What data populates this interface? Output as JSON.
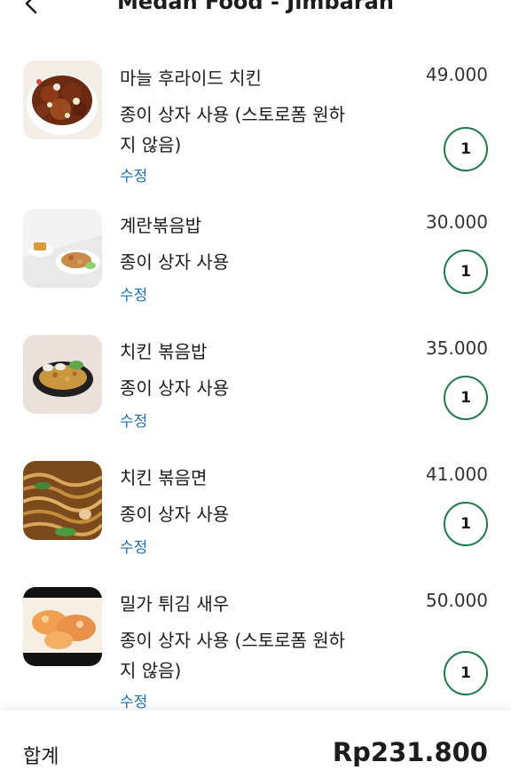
{
  "header": {
    "title": "Medan Food - Jimbaran"
  },
  "items": [
    {
      "name": "마늘 후라이드 치킨",
      "price": "49.000",
      "option": "종이 상자 사용 (스토로폼 원하지 않음)",
      "edit": "수정",
      "qty": "1"
    },
    {
      "name": "계란볶음밥",
      "price": "30.000",
      "option": "종이 상자 사용",
      "edit": "수정",
      "qty": "1"
    },
    {
      "name": "치킨 볶음밥",
      "price": "35.000",
      "option": "종이 상자 사용",
      "edit": "수정",
      "qty": "1"
    },
    {
      "name": "치킨 볶음면",
      "price": "41.000",
      "option": "종이 상자 사용",
      "edit": "수정",
      "qty": "1"
    },
    {
      "name": "밀가 튀김 새우",
      "price": "50.000",
      "option": "종이 상자 사용 (스토로폼 원하지 않음)",
      "edit": "수정",
      "qty": "1"
    }
  ],
  "footer": {
    "total_label": "합계",
    "total_value": "Rp231.800"
  },
  "colors": {
    "accent": "#1b7a46",
    "link": "#1a73b8"
  }
}
